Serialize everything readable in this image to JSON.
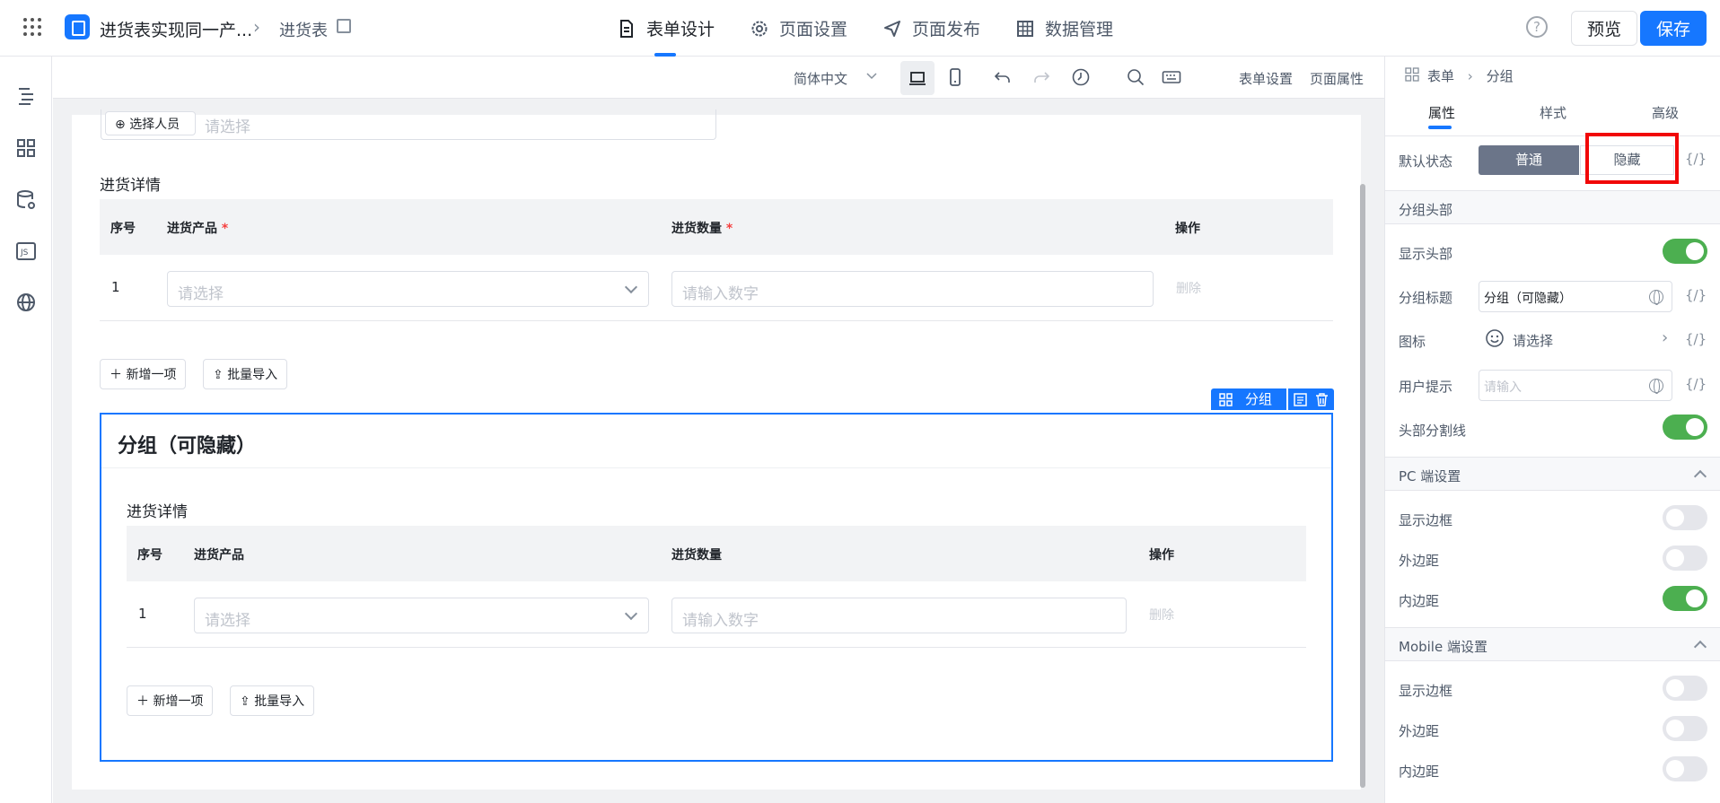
{
  "header": {
    "app_title": "进货表实现同一产...",
    "breadcrumb_page": "进货表",
    "tabs": [
      {
        "label": "表单设计",
        "active": true
      },
      {
        "label": "页面设置",
        "active": false
      },
      {
        "label": "页面发布",
        "active": false
      },
      {
        "label": "数据管理",
        "active": false
      }
    ],
    "help": "?",
    "preview_label": "预览",
    "save_label": "保存"
  },
  "toolbar": {
    "language": "简体中文",
    "form_settings": "表单设置",
    "page_props": "页面属性"
  },
  "form": {
    "select_person_label": "选择人员",
    "select_placeholder": "请选择",
    "detail_title": "进货详情",
    "table1": {
      "headers": [
        "序号",
        "进货产品",
        "进货数量",
        "操作"
      ],
      "required_mark": "*",
      "row": {
        "index": "1",
        "product_placeholder": "请选择",
        "qty_placeholder": "请输入数字",
        "action": "删除"
      }
    },
    "add_item": "新增一项",
    "batch_import": "批量导入",
    "group": {
      "tag_label": "分组",
      "title": "分组（可隐藏）",
      "detail_title": "进货详情",
      "headers": [
        "序号",
        "进货产品",
        "进货数量",
        "操作"
      ],
      "row": {
        "index": "1",
        "product_placeholder": "请选择",
        "qty_placeholder": "请输入数字",
        "action": "删除"
      },
      "add_item": "新增一项",
      "batch_import": "批量导入"
    }
  },
  "right_panel": {
    "breadcrumb": [
      "表单",
      "分组"
    ],
    "tabs": [
      "属性",
      "样式",
      "高级"
    ],
    "default_state_label": "默认状态",
    "state_options": [
      "普通",
      "隐藏"
    ],
    "code_icon": "{/}",
    "section_header": "分组头部",
    "show_header": "显示头部",
    "group_title_label": "分组标题",
    "group_title_value": "分组（可隐藏）",
    "icon_label": "图标",
    "icon_placeholder": "请选择",
    "user_hint_label": "用户提示",
    "user_hint_placeholder": "请输入",
    "header_divider": "头部分割线",
    "pc_section": "PC 端设置",
    "mobile_section": "Mobile 端设置",
    "show_border": "显示边框",
    "margin": "外边距",
    "padding": "内边距",
    "toggles": {
      "show_header": true,
      "header_divider": true,
      "pc_border": false,
      "pc_margin": false,
      "pc_padding": true,
      "mobile_border": false,
      "mobile_margin": false,
      "mobile_padding": false
    }
  },
  "colors": {
    "accent": "#1677ff",
    "toggle_on": "#4caf50",
    "highlight": "#f10707",
    "segment_active": "#6b7589"
  }
}
